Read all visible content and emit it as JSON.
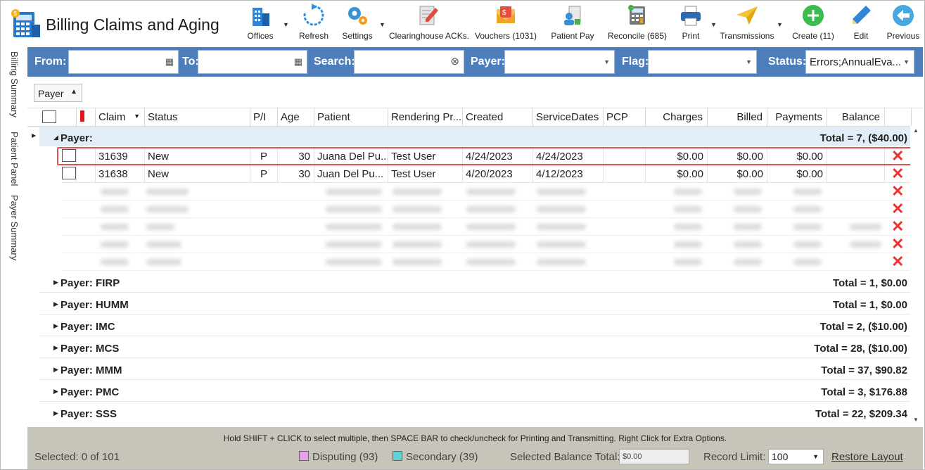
{
  "app": {
    "title": "Billing Claims and Aging"
  },
  "toolbar": {
    "offices": "Offices",
    "refresh": "Refresh",
    "settings": "Settings",
    "clearinghouse": "Clearinghouse ACKs.",
    "vouchers": "Vouchers (1031)",
    "patient_pay": "Patient Pay",
    "reconcile": "Reconcile (685)",
    "print": "Print",
    "transmissions": "Transmissions",
    "create": "Create (11)",
    "edit": "Edit",
    "previous": "Previous"
  },
  "sidebar": {
    "tabs": [
      "Billing Summary",
      "Patient Panel",
      "Payer Summary"
    ]
  },
  "filters": {
    "from_label": "From:",
    "to_label": "To:",
    "search_label": "Search:",
    "payer_label": "Payer:",
    "flag_label": "Flag:",
    "status_label": "Status:",
    "status_value": "Errors;AnnualEva..."
  },
  "group_by": "Payer",
  "columns": [
    "Claim",
    "Status",
    "P/I",
    "Age",
    "Patient",
    "Rendering Pr...",
    "Created",
    "ServiceDates",
    "PCP",
    "Charges",
    "Billed",
    "Payments",
    "Balance"
  ],
  "groups": {
    "open": {
      "name": "Payer:",
      "total": "Total = 7,  ($40.00)"
    },
    "rows": [
      {
        "claim": "31639",
        "status": "New",
        "pi": "P",
        "age": "30",
        "patient": "Juana Del Pu...",
        "rendering": "Test User",
        "created": "4/24/2023",
        "service": "4/24/2023",
        "pcp": "",
        "charges": "$0.00",
        "billed": "$0.00",
        "payments": "$0.00",
        "balance": ""
      },
      {
        "claim": "31638",
        "status": "New",
        "pi": "P",
        "age": "30",
        "patient": "Juan  Del Pu...",
        "rendering": "Test User",
        "created": "4/20/2023",
        "service": "4/12/2023",
        "pcp": "",
        "charges": "$0.00",
        "billed": "$0.00",
        "payments": "$0.00",
        "balance": ""
      }
    ],
    "collapsed": [
      {
        "name": "Payer: FIRP",
        "total": "Total = 1,  $0.00"
      },
      {
        "name": "Payer: HUMM",
        "total": "Total = 1,  $0.00"
      },
      {
        "name": "Payer: IMC",
        "total": "Total = 2,  ($10.00)"
      },
      {
        "name": "Payer: MCS",
        "total": "Total = 28,  ($10.00)"
      },
      {
        "name": "Payer: MMM",
        "total": "Total = 37,  $90.82"
      },
      {
        "name": "Payer: PMC",
        "total": "Total = 3,  $176.88"
      },
      {
        "name": "Payer: SSS",
        "total": "Total = 22,  $209.34"
      }
    ]
  },
  "status_bar": {
    "hint": "Hold SHIFT + CLICK to select multiple, then SPACE BAR to check/uncheck for Printing and Transmitting. Right Click for Extra Options.",
    "selected": "Selected: 0 of 101",
    "disputing": "Disputing (93)",
    "secondary": "Secondary (39)",
    "selected_balance_label": "Selected Balance Total:",
    "selected_balance_value": "$0.00",
    "record_limit_label": "Record Limit:",
    "record_limit_value": "100",
    "restore_layout": "Restore Layout"
  },
  "colors": {
    "filter_bar": "#4e7dbc",
    "status_bar": "#c7c5ba",
    "disputing": "#e8a0e8",
    "secondary": "#5fd3d3",
    "delete": "#e33333",
    "highlight": "#e0564f"
  }
}
